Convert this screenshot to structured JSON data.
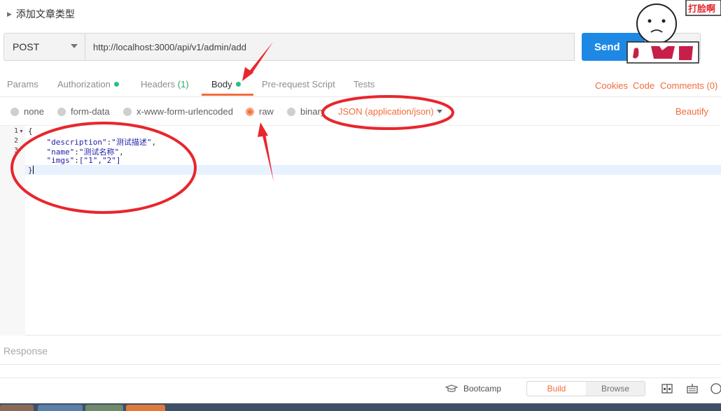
{
  "request": {
    "name": "添加文章类型"
  },
  "url_bar": {
    "method": "POST",
    "url": "http://localhost:3000/api/v1/admin/add",
    "send_label": "Send"
  },
  "tabs": [
    {
      "label": "Params"
    },
    {
      "label": "Authorization"
    },
    {
      "label": "Headers",
      "count": "(1)"
    },
    {
      "label": "Body"
    },
    {
      "label": "Pre-request Script"
    },
    {
      "label": "Tests"
    }
  ],
  "links": {
    "cookies": "Cookies",
    "code": "Code",
    "comments": "Comments (0)"
  },
  "body_modes": [
    "none",
    "form-data",
    "x-www-form-urlencoded",
    "raw",
    "binary"
  ],
  "content_type": "JSON (application/json)",
  "beautify": "Beautify",
  "editor": {
    "line_numbers": [
      "1",
      "2",
      "3",
      "",
      ""
    ],
    "lines": [
      {
        "text": "{"
      },
      {
        "key": "\"description\"",
        "value": "\"测试描述\"",
        "suffix": ","
      },
      {
        "key": "\"name\"",
        "value": "\"测试名称\"",
        "suffix": ","
      },
      {
        "key": "\"imgs\"",
        "value": "[\"1\",\"2\"]",
        "suffix": ""
      },
      {
        "text": "}"
      }
    ]
  },
  "response": {
    "label": "Response"
  },
  "status_bar": {
    "bootcamp": "Bootcamp",
    "build": "Build",
    "browse": "Browse"
  },
  "sticker": {
    "text": "打脸啊",
    "icons": [
      "sad-face-icon",
      "shirt-icon"
    ]
  },
  "colors": {
    "accent": "#f26b3a",
    "send": "#1e88e5",
    "annotation": "#e8262d",
    "dot": "#2ac07f"
  }
}
